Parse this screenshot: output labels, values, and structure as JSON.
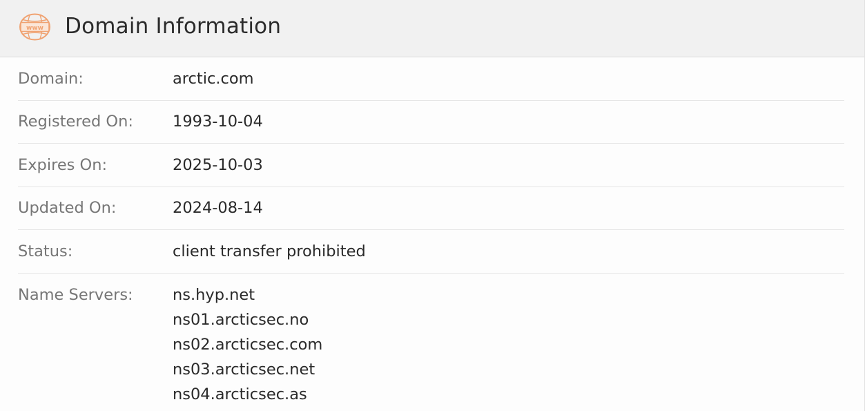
{
  "header": {
    "icon": "www-globe-icon",
    "icon_text": "www",
    "accent_color": "#f0a271",
    "title": "Domain Information"
  },
  "rows": [
    {
      "label": "Domain:",
      "value": "arctic.com"
    },
    {
      "label": "Registered On:",
      "value": "1993-10-04"
    },
    {
      "label": "Expires On:",
      "value": "2025-10-03"
    },
    {
      "label": "Updated On:",
      "value": "2024-08-14"
    },
    {
      "label": "Status:",
      "value": "client transfer prohibited"
    }
  ],
  "name_servers": {
    "label": "Name Servers:",
    "values": [
      "ns.hyp.net",
      "ns01.arcticsec.no",
      "ns02.arcticsec.com",
      "ns03.arcticsec.net",
      "ns04.arcticsec.as"
    ]
  }
}
